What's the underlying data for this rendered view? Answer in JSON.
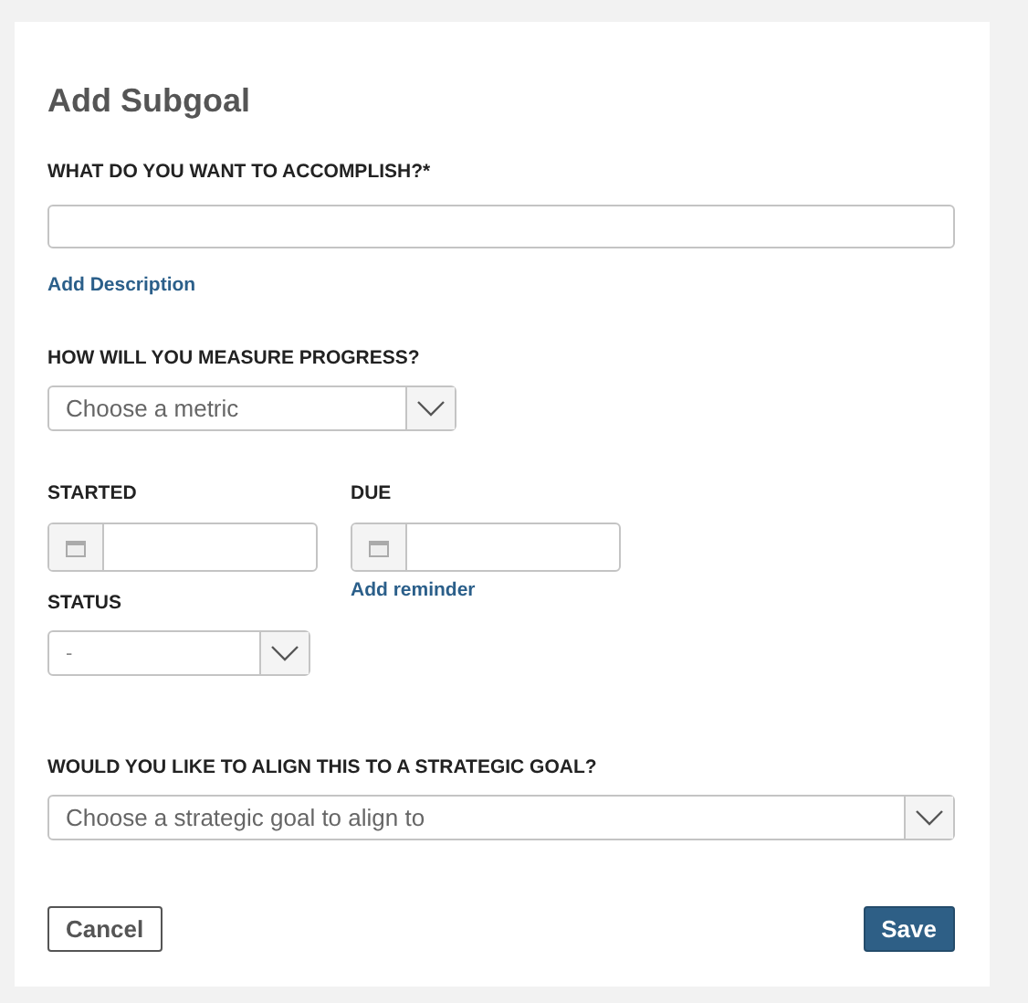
{
  "title": "Add Subgoal",
  "accomplish": {
    "label": "WHAT DO YOU WANT TO ACCOMPLISH?*",
    "link": "Add Description"
  },
  "measure": {
    "label": "HOW WILL YOU MEASURE PROGRESS?",
    "placeholder": "Choose a metric"
  },
  "started": {
    "label": "STARTED"
  },
  "due": {
    "label": "DUE",
    "link": "Add reminder"
  },
  "status": {
    "label": "STATUS",
    "value": "-"
  },
  "align": {
    "label": "WOULD YOU LIKE TO ALIGN THIS TO A STRATEGIC GOAL?",
    "placeholder": "Choose a strategic goal to align to"
  },
  "buttons": [
    {
      "label": "Cancel",
      "kind": "secondary"
    },
    {
      "label": "Save",
      "kind": "primary"
    }
  ]
}
